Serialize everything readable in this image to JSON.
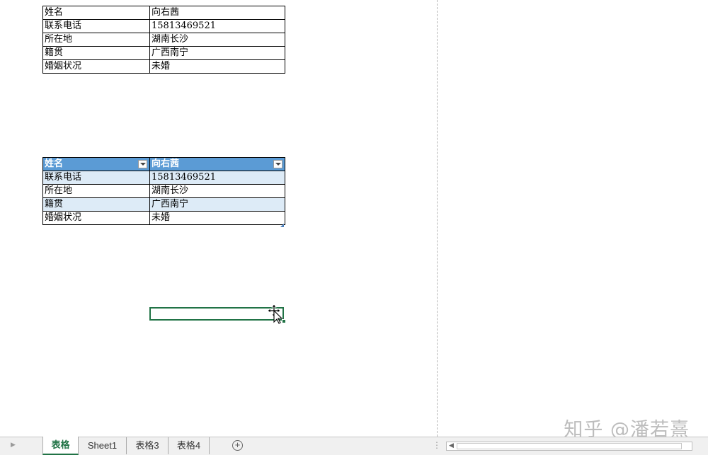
{
  "table1": {
    "rows": [
      {
        "label": "姓名",
        "value": "向右茜"
      },
      {
        "label": "联系电话",
        "value": "15813469521"
      },
      {
        "label": "所在地",
        "value": "湖南长沙"
      },
      {
        "label": "籍贯",
        "value": "广西南宁"
      },
      {
        "label": "婚姻状况",
        "value": "未婚"
      }
    ]
  },
  "table2": {
    "header": {
      "col1": "姓名",
      "col2": "向右茜"
    },
    "rows": [
      {
        "label": "联系电话",
        "value": "15813469521"
      },
      {
        "label": "所在地",
        "value": "湖南长沙"
      },
      {
        "label": "籍贯",
        "value": "广西南宁"
      },
      {
        "label": "婚姻状况",
        "value": "未婚"
      }
    ],
    "header_color": "#5b9bd5",
    "band_color": "#ddebf7"
  },
  "sheet_tabs": [
    {
      "label": "表格",
      "active": true
    },
    {
      "label": "Sheet1",
      "active": false
    },
    {
      "label": "表格3",
      "active": false
    },
    {
      "label": "表格4",
      "active": false
    }
  ],
  "icons": {
    "add_sheet": "plus-circle-icon",
    "dropdown": "filter-dropdown-icon",
    "cursor": "move-cursor-icon"
  },
  "watermark": "知乎 @潘若熹",
  "accent_color": "#217346"
}
